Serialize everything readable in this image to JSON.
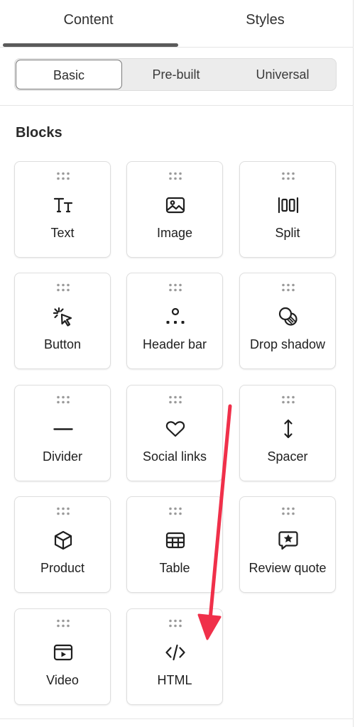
{
  "tabs": {
    "content": "Content",
    "styles": "Styles"
  },
  "segment": {
    "basic": "Basic",
    "prebuilt": "Pre-built",
    "universal": "Universal",
    "selected": "Basic"
  },
  "section_title": "Blocks",
  "blocks": [
    {
      "label": "Text",
      "icon": "text-icon"
    },
    {
      "label": "Image",
      "icon": "image-icon"
    },
    {
      "label": "Split",
      "icon": "split-icon"
    },
    {
      "label": "Button",
      "icon": "cursor-click-icon"
    },
    {
      "label": "Header bar",
      "icon": "header-bar-icon"
    },
    {
      "label": "Drop shadow",
      "icon": "drop-shadow-icon"
    },
    {
      "label": "Divider",
      "icon": "divider-icon"
    },
    {
      "label": "Social links",
      "icon": "heart-icon"
    },
    {
      "label": "Spacer",
      "icon": "vertical-arrows-icon"
    },
    {
      "label": "Product",
      "icon": "cube-icon"
    },
    {
      "label": "Table",
      "icon": "table-icon"
    },
    {
      "label": "Review quote",
      "icon": "star-quote-icon"
    },
    {
      "label": "Video",
      "icon": "video-icon"
    },
    {
      "label": "HTML",
      "icon": "code-icon"
    }
  ],
  "colors": {
    "annotation_arrow": "#f0304a",
    "tab_underline": "#5b5b5b"
  }
}
